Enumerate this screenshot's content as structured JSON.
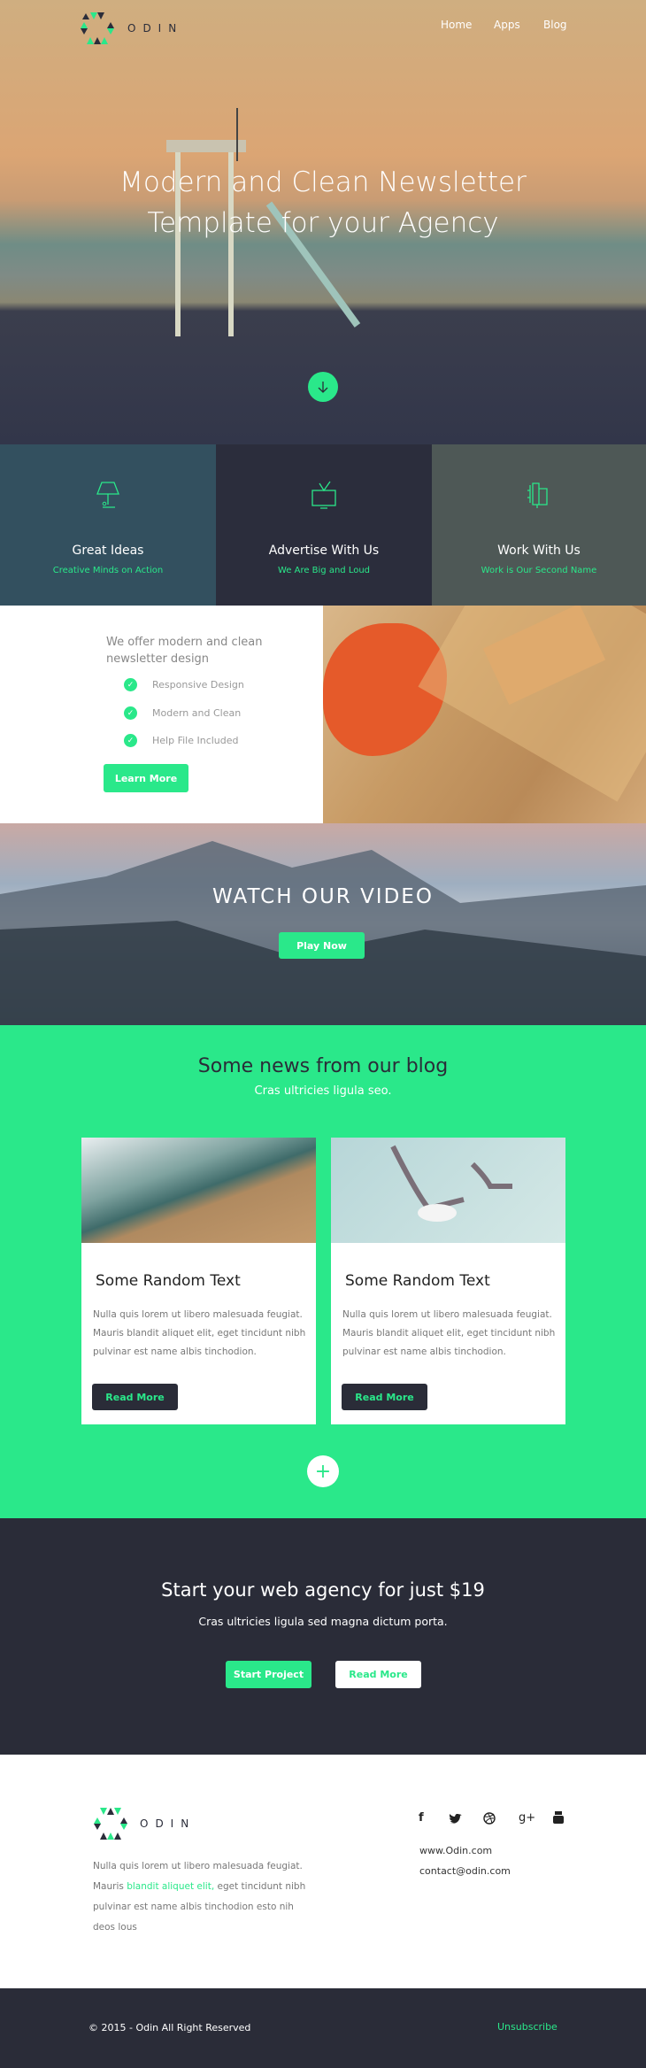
{
  "header": {
    "brand": "ODIN",
    "nav": [
      "Home",
      "Apps",
      "Blog"
    ]
  },
  "hero": {
    "title_line1": "Modern and Clean Newsletter",
    "title_line2": "Template for your Agency",
    "scroll_icon": "arrow-down-icon"
  },
  "features": [
    {
      "icon": "lamp-icon",
      "title": "Great Ideas",
      "subtitle": "Creative Minds on Action",
      "bg": "#33505f"
    },
    {
      "icon": "tv-icon",
      "title": "Advertise With Us",
      "subtitle": "We Are Big and Loud",
      "bg": "#2b2d3c"
    },
    {
      "icon": "plug-icon",
      "title": "Work With Us",
      "subtitle": "Work is Our Second Name",
      "bg": "#4e5856"
    }
  ],
  "offer": {
    "heading_line1": "We offer modern and clean",
    "heading_line2": "newsletter design",
    "items": [
      "Responsive Design",
      "Modern and Clean",
      "Help File Included"
    ],
    "button": "Learn More"
  },
  "video": {
    "title": "WATCH OUR VIDEO",
    "button": "Play Now"
  },
  "blog": {
    "title": "Some news from our blog",
    "subtitle": "Cras ultricies ligula seo.",
    "posts": [
      {
        "title": "Some Random Text",
        "text": "Nulla quis lorem ut libero malesuada feugiat. Mauris blandit aliquet elit, eget tincidunt nibh pulvinar est name albis tinchodion.",
        "button": "Read More"
      },
      {
        "title": "Some Random Text",
        "text": "Nulla quis lorem ut libero malesuada feugiat. Mauris blandit aliquet elit, eget tincidunt nibh pulvinar est name albis tinchodion.",
        "button": "Read More"
      }
    ],
    "more_icon": "plus-icon"
  },
  "cta": {
    "title": "Start your web agency for just $19",
    "subtitle": "Cras ultricies ligula sed magna dictum porta.",
    "primary": "Start Project",
    "secondary": "Read More"
  },
  "footer": {
    "brand": "ODIN",
    "text_before": "Nulla quis lorem ut libero malesuada feugiat. Mauris ",
    "text_link": "blandit aliquet elit,",
    "text_after": " eget tincidunt nibh pulvinar est name albis tinchodion esto nih deos lous",
    "social": [
      "f",
      "t",
      "d",
      "g+",
      "yt"
    ],
    "website": "www.Odin.com",
    "email": "contact@odin.com",
    "copyright": "© 2015 - Odin All Right Reserved",
    "unsubscribe": "Unsubscribe"
  },
  "colors": {
    "accent": "#2ae88a",
    "dark": "#2a2c38"
  }
}
